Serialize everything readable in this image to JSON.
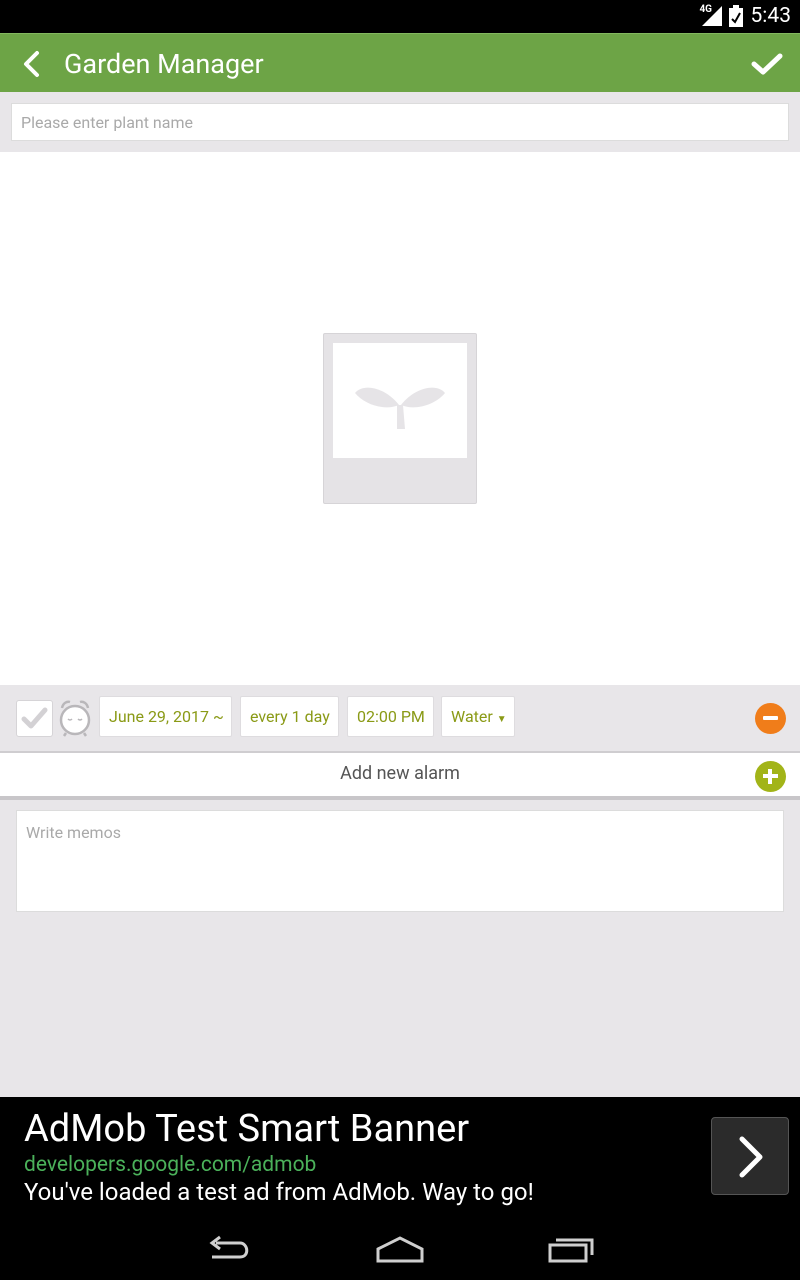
{
  "status_bar": {
    "network": "4G",
    "time": "5:43"
  },
  "app_bar": {
    "title": "Garden Manager",
    "back_icon": "back-arrow-icon",
    "confirm_icon": "check-icon"
  },
  "plant_name": {
    "value": "",
    "placeholder": "Please enter plant name"
  },
  "photo": {
    "icon": "sprout-icon"
  },
  "alarm": {
    "enabled": false,
    "start_date": "June 29, 2017 ~",
    "frequency": "every 1 day",
    "time": "02:00 PM",
    "type": "Water",
    "type_arrow": "▼"
  },
  "add_alarm": {
    "label": "Add new alarm"
  },
  "memo": {
    "value": "",
    "placeholder": "Write memos"
  },
  "ad": {
    "title": "AdMob Test Smart Banner",
    "url": "developers.google.com/admob",
    "body": "You've loaded a test ad from AdMob. Way to go!"
  },
  "colors": {
    "app_bar": "#6da446",
    "accent_text": "#8a9a16",
    "remove": "#f07d1a",
    "add": "#a2b418"
  }
}
